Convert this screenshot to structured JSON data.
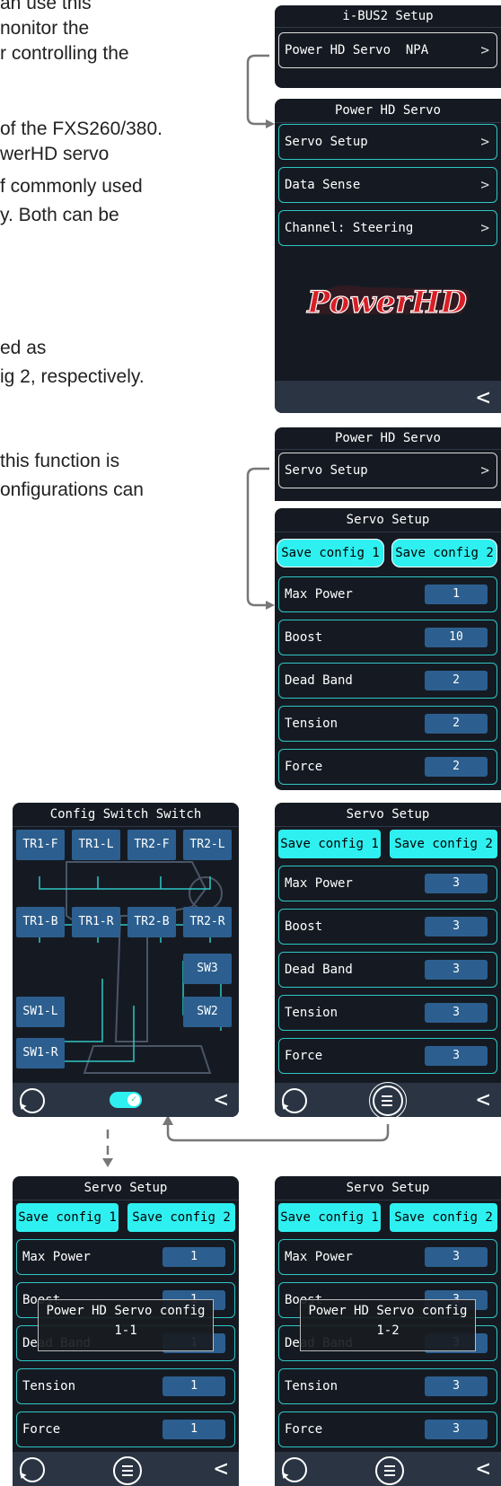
{
  "doc_text": [
    "an use this",
    "nonitor the",
    "r controlling the",
    "of the FXS260/380.",
    "werHD servo",
    "f commonly used",
    "y. Both can be",
    "ed as",
    "ig 2, respectively.",
    "this function is",
    "onfigurations can"
  ],
  "ibus": {
    "title": "i-BUS2 Setup",
    "row_label": "Power HD Servo  NPA"
  },
  "phd": {
    "title": "Power HD Servo",
    "rows": [
      "Servo Setup",
      "Data Sense",
      "Channel: Steering"
    ],
    "logo": "PowerHD"
  },
  "phd2": {
    "title": "Power HD Servo",
    "row_label": "Servo Setup"
  },
  "servo": {
    "title": "Servo Setup",
    "save1": "Save config 1",
    "save2": "Save config 2",
    "labels": [
      "Max Power",
      "Boost",
      "Dead Band",
      "Tension",
      "Force"
    ]
  },
  "servo_a": {
    "values": [
      "1",
      "10",
      "2",
      "2",
      "2"
    ]
  },
  "servo_b": {
    "values": [
      "3",
      "3",
      "3",
      "3",
      "3"
    ]
  },
  "servo_c": {
    "values": [
      "1",
      "1",
      "1",
      "1",
      "1"
    ]
  },
  "servo_d": {
    "values": [
      "3",
      "3",
      "3",
      "3",
      "3"
    ]
  },
  "cfg": {
    "title": "Config Switch Switch",
    "buttons": [
      "TR1-F",
      "TR1-L",
      "TR2-F",
      "TR2-L",
      "TR1-B",
      "TR1-R",
      "TR2-B",
      "TR2-R",
      "SW3",
      "SW1-L",
      "SW2",
      "SW1-R"
    ]
  },
  "popup_c": {
    "title": "Power HD Servo config",
    "sub": "1-1"
  },
  "popup_d": {
    "title": "Power HD Servo config",
    "sub": "1-2"
  },
  "colors": {
    "cyan": "#2ff0f0",
    "screen": "#151a22",
    "value_box": "#2c5f8f",
    "row_border": "#2ec6c6",
    "logo_red": "#d81e24"
  },
  "icons": [
    "chevron-right-icon",
    "back-arrow-icon",
    "rotate-icon",
    "menu-icon",
    "toggle-switch-icon"
  ]
}
